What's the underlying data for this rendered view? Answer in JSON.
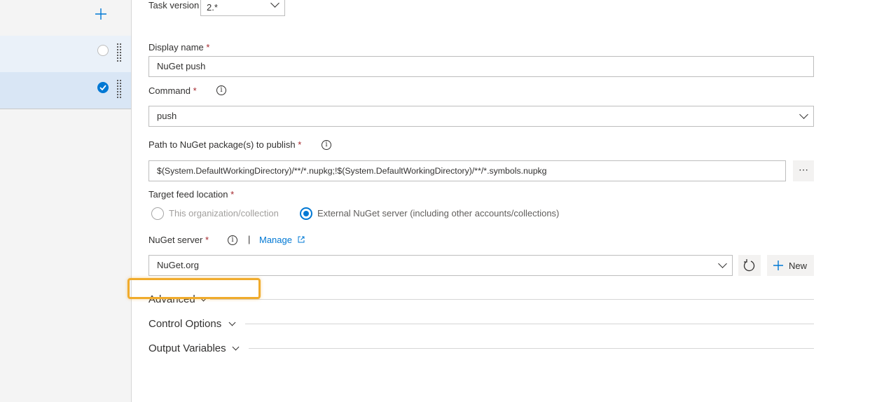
{
  "sidebar": {
    "add_icon": "plus-icon",
    "tasks": [
      {
        "status": "unchecked",
        "icon": "circle-icon"
      },
      {
        "status": "checked",
        "icon": "check-circle-icon",
        "selected": true
      }
    ]
  },
  "form": {
    "task_version": {
      "label": "Task version",
      "value": "2.*"
    },
    "display_name": {
      "label": "Display name",
      "required": "*",
      "value": "NuGet push"
    },
    "command": {
      "label": "Command",
      "required": "*",
      "value": "push"
    },
    "path": {
      "label": "Path to NuGet package(s) to publish",
      "required": "*",
      "value": "$(System.DefaultWorkingDirectory)/**/*.nupkg;!$(System.DefaultWorkingDirectory)/**/*.symbols.nupkg",
      "browse_label": "⋯"
    },
    "target_feed": {
      "label": "Target feed location",
      "required": "*",
      "options": [
        {
          "label": "This organization/collection",
          "selected": false
        },
        {
          "label": "External NuGet server (including other accounts/collections)",
          "selected": true
        }
      ]
    },
    "nuget_server": {
      "label": "NuGet server",
      "required": "*",
      "separator": "|",
      "manage_label": "Manage",
      "value": "NuGet.org",
      "new_label": "New"
    },
    "info_glyph": "i"
  },
  "sections": {
    "advanced": "Advanced",
    "control_options": "Control Options",
    "output_variables": "Output Variables"
  },
  "colors": {
    "accent": "#0078d4",
    "highlight": "#f0ab2c",
    "required": "#a4262c"
  }
}
